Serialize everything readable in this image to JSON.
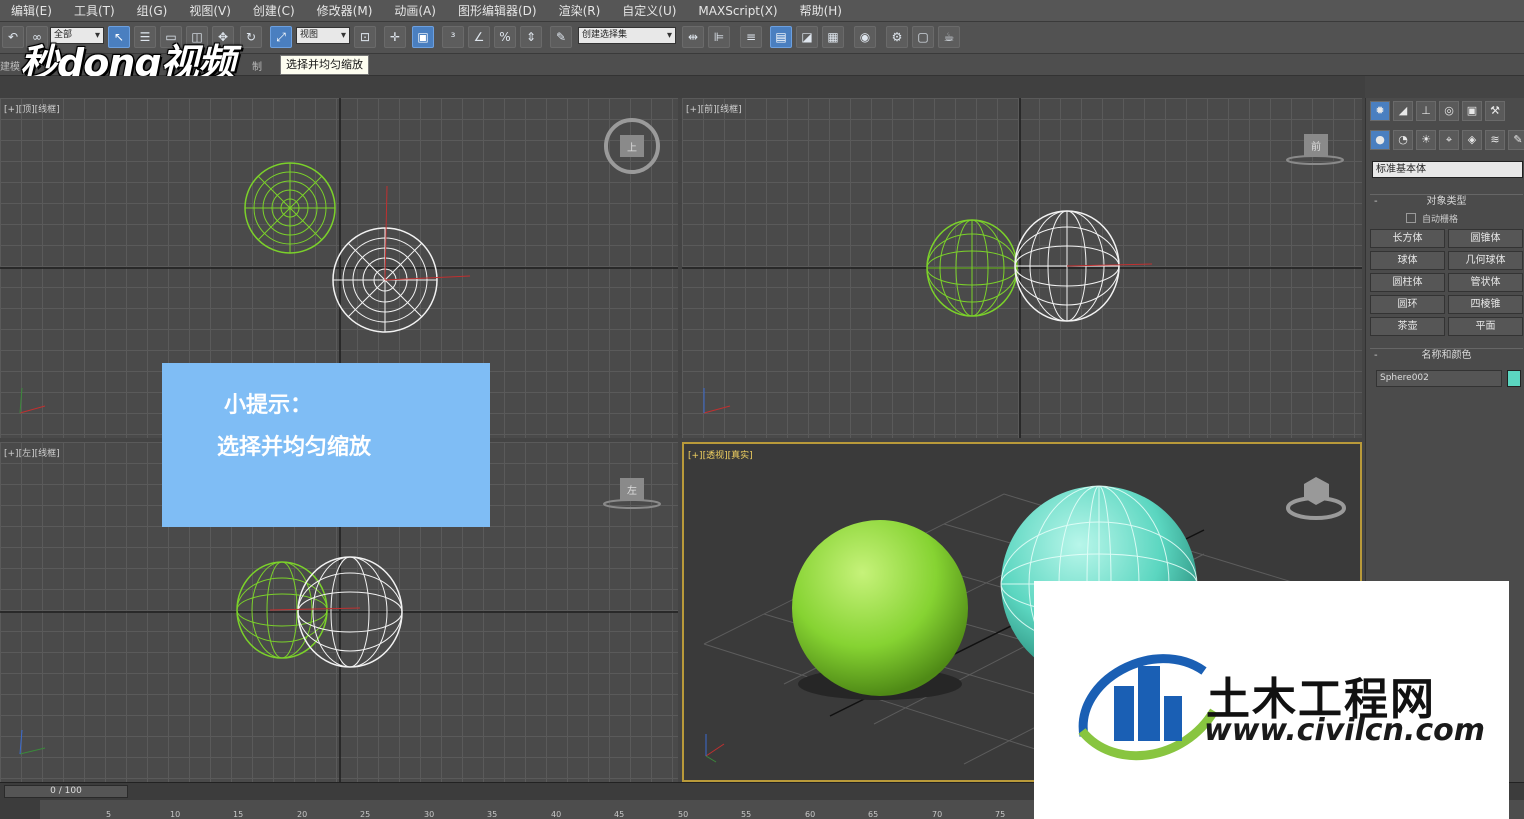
{
  "menu": [
    "编辑(E)",
    "工具(T)",
    "组(G)",
    "视图(V)",
    "创建(C)",
    "修改器(M)",
    "动画(A)",
    "图形编辑器(D)",
    "渲染(R)",
    "自定义(U)",
    "MAXScript(X)",
    "帮助(H)"
  ],
  "toolbar": {
    "selection_filter": "全部",
    "ref_coord": "视图",
    "named_sel_set": "创建选择集",
    "tooltip": "选择并均匀缩放",
    "ribbon_left": "建模",
    "ribbon_mid": "制"
  },
  "watermark": {
    "logo_text": "秒dong视频"
  },
  "viewports": {
    "top": "[+][顶][线框]",
    "front": "[+][前][线框]",
    "left": "[+][左][线框]",
    "perspective": "[+][透视][真实]"
  },
  "viewcube_labels": {
    "top": "上",
    "front": "前",
    "left": "左"
  },
  "tip": {
    "title": "小提示：",
    "text": "选择并均匀缩放"
  },
  "command_panel": {
    "tabs": [
      "create-icon",
      "modify-icon",
      "hierarchy-icon",
      "motion-icon",
      "display-icon",
      "utilities-icon"
    ],
    "sub_tabs": [
      "geometry-icon",
      "shapes-icon",
      "lights-icon",
      "cameras-icon",
      "helpers-icon",
      "spacewarps-icon",
      "systems-icon"
    ],
    "category": "标准基本体",
    "object_type_header": "对象类型",
    "auto_grid": "自动栅格",
    "object_buttons": [
      "长方体",
      "圆锥体",
      "球体",
      "几何球体",
      "圆柱体",
      "管状体",
      "圆环",
      "四棱锥",
      "茶壶",
      "平面"
    ],
    "name_color_header": "名称和颜色",
    "object_name": "Sphere002",
    "object_color": "#5bd6c0"
  },
  "timeline": {
    "frame": "0 / 100",
    "ticks": [
      "5",
      "10",
      "15",
      "20",
      "25",
      "30",
      "35",
      "40",
      "45",
      "50",
      "55",
      "60",
      "65",
      "70",
      "75"
    ]
  },
  "civil_logo": {
    "cn": "土木工程网",
    "url": "www.civilcn.com"
  },
  "colors": {
    "green_sphere": "#8bd93a",
    "cyan_sphere": "#5bd6c0",
    "tip_bg": "#7fbdf5",
    "active_btn": "#4a7fc0"
  }
}
